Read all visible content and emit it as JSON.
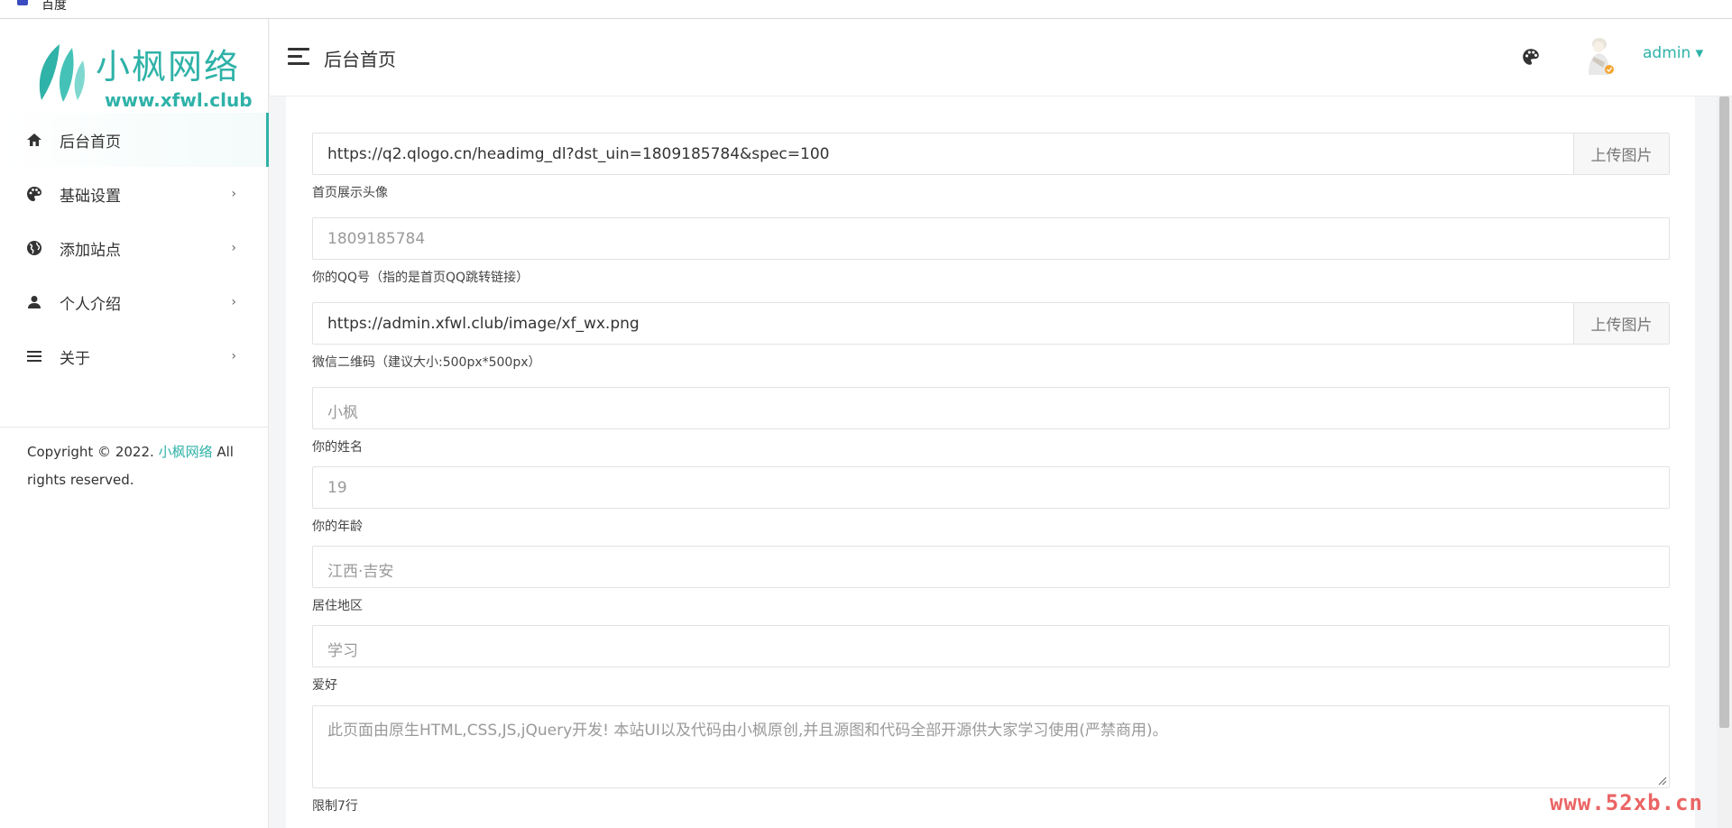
{
  "browser": {
    "tab_title": "百度"
  },
  "brand": {
    "logo_title": "小枫网络",
    "logo_url": "www.xfwl.club",
    "accent": "#2fb2a8"
  },
  "header": {
    "page_title": "后台首页",
    "user_name": "admin ▾"
  },
  "sidebar": {
    "items": [
      {
        "label": "后台首页",
        "icon": "home-icon",
        "active": true
      },
      {
        "label": "基础设置",
        "icon": "palette-icon",
        "arrow": "›"
      },
      {
        "label": "添加站点",
        "icon": "globe-icon",
        "arrow": "›"
      },
      {
        "label": "个人介绍",
        "icon": "person-icon",
        "arrow": "›"
      },
      {
        "label": "关于",
        "icon": "list-icon",
        "arrow": "›"
      }
    ],
    "copyright_prefix": "Copyright © 2022.",
    "copyright_brand": "小枫网络",
    "copyright_suffix": "All rights reserved."
  },
  "form": {
    "avatar_url": {
      "value": "https://q2.qlogo.cn/headimg_dl?dst_uin=1809185784&spec=100",
      "button": "上传图片",
      "label": "首页展示头像"
    },
    "qq": {
      "placeholder": "1809185784",
      "label": "你的QQ号（指的是首页QQ跳转链接）"
    },
    "wechat_qr": {
      "value": "https://admin.xfwl.club/image/xf_wx.png",
      "button": "上传图片",
      "label": "微信二维码（建议大小:500px*500px）"
    },
    "name": {
      "placeholder": "小枫",
      "label": "你的姓名"
    },
    "age": {
      "placeholder": "19",
      "label": "你的年龄"
    },
    "location": {
      "placeholder": "江西·吉安",
      "label": "居住地区"
    },
    "hobby": {
      "placeholder": "学习",
      "label": "爱好"
    },
    "intro": {
      "placeholder": "此页面由原生HTML,CSS,JS,jQuery开发! 本站UI以及代码由小枫原创,并且源图和代码全部开源供大家学习使用(严禁商用)。",
      "label": "限制7行"
    }
  },
  "watermark": "www.52xb.cn"
}
